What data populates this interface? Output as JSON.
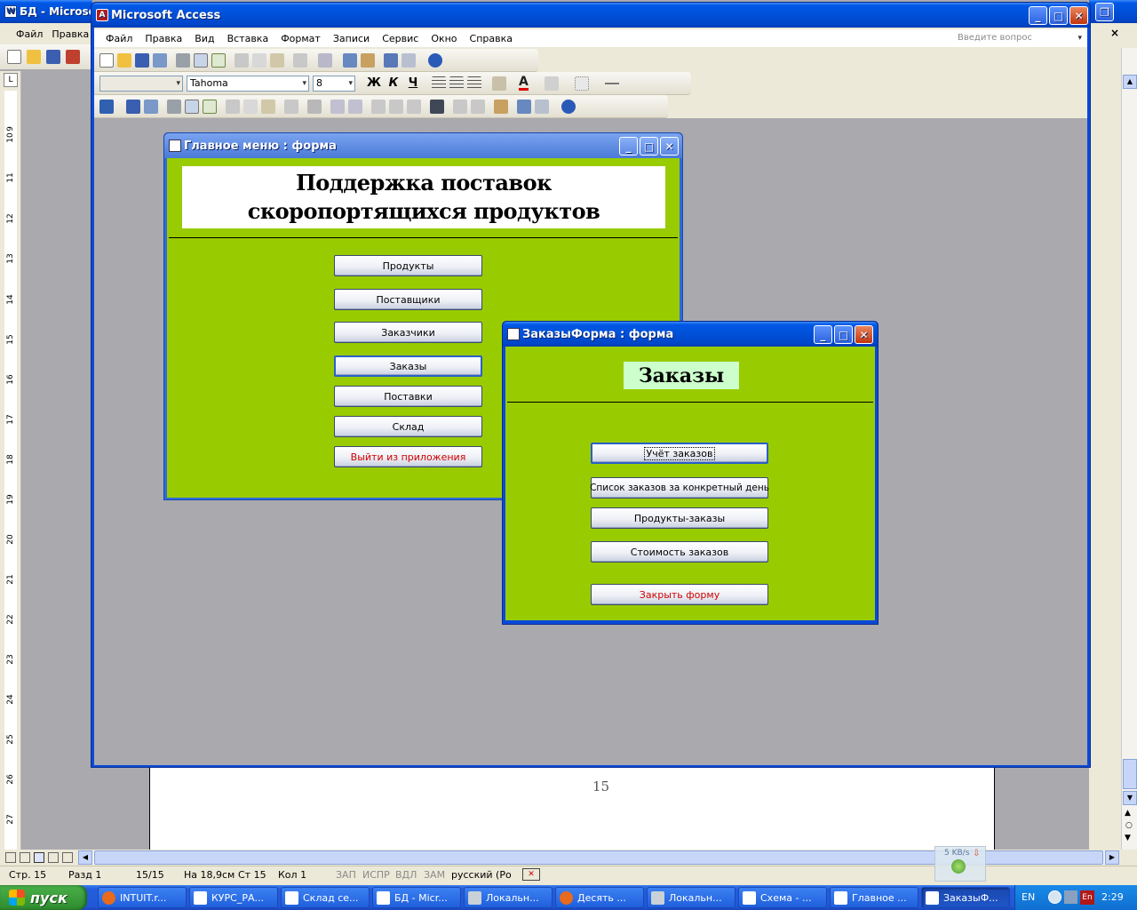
{
  "word": {
    "title_fragment": "БД - Microsoft",
    "menu": [
      "Файл",
      "Правка"
    ],
    "page_number": "15",
    "ruler_numbers": [
      "9",
      "10",
      "11",
      "12",
      "13",
      "14",
      "15",
      "16",
      "17",
      "18",
      "19",
      "20",
      "21",
      "22",
      "23",
      "24",
      "25",
      "26",
      "27"
    ],
    "status": {
      "page": "Стр. 15",
      "section": "Разд 1",
      "pages": "15/15",
      "position": "На 18,9см",
      "line": "Ст 15",
      "column": "Кол 1",
      "rec": "ЗАП",
      "trk": "ИСПР",
      "ext": "ВДЛ",
      "ovr": "ЗАМ",
      "language": "русский (Ро"
    },
    "net_speed": "5 KB/s"
  },
  "access": {
    "title": "Microsoft Access",
    "menu": [
      "Файл",
      "Правка",
      "Вид",
      "Вставка",
      "Формат",
      "Записи",
      "Сервис",
      "Окно",
      "Справка"
    ],
    "help_placeholder": "Введите вопрос",
    "font_name": "Tahoma",
    "font_size": "8",
    "fmt_bold": "Ж",
    "fmt_italic": "К",
    "fmt_underline": "Ч",
    "font_color_letter": "A"
  },
  "main_form": {
    "title": "Главное меню : форма",
    "heading": "Поддержка поставок скоропортящихся продуктов",
    "buttons": [
      "Продукты",
      "Поставщики",
      "Заказчики",
      "Заказы",
      "Поставки",
      "Склад"
    ],
    "exit_button": "Выйти из приложения"
  },
  "orders_form": {
    "title": "ЗаказыФорма : форма",
    "heading": "Заказы",
    "buttons": [
      "Учёт заказов",
      "Список заказов за конкретный день",
      "Продукты-заказы",
      "Стоимость заказов"
    ],
    "close_button": "Закрыть форму"
  },
  "taskbar": {
    "start": "пуск",
    "items": [
      "INTUIT.r...",
      "КУРС_РА...",
      "Склад се...",
      "БД - Micr...",
      "Локальн...",
      "Десять ...",
      "Локальн...",
      "Схема - ...",
      "Главное ...",
      "ЗаказыФ..."
    ],
    "lang": "EN",
    "time": "2:29"
  },
  "colors": {
    "form_bg": "#99cc00",
    "xp_blue": "#0054e3",
    "exit_text": "#d00000",
    "canvas_gray": "#aaa9ae"
  }
}
